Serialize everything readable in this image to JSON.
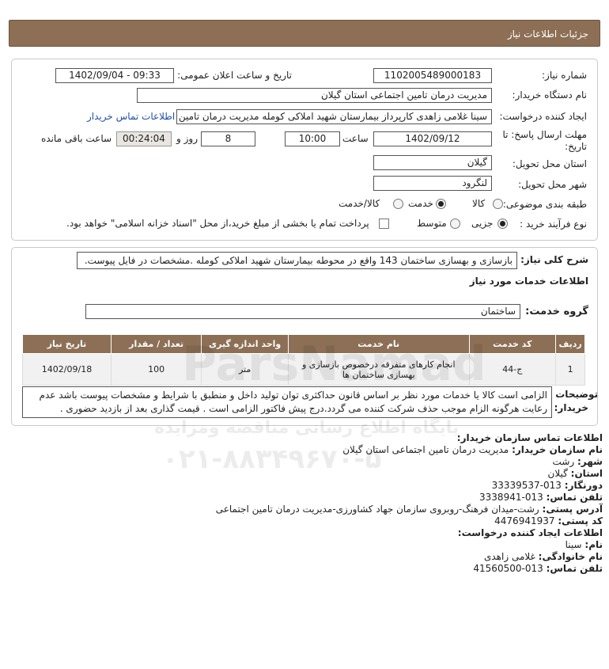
{
  "header": {
    "title": "جزئیات اطلاعات نیاز"
  },
  "form": {
    "need_number_label": "شماره نیاز:",
    "need_number": "1102005489000183",
    "announce_label": "تاریخ و ساعت اعلان عمومی:",
    "announce_value": "1402/09/04 - 09:33",
    "buyer_org_label": "نام دستگاه خریدار:",
    "buyer_org": "مدیریت درمان تامین اجتماعی استان گیلان",
    "creator_label": "ایجاد کننده درخواست:",
    "creator": "سینا غلامی زاهدی کارپرداز بیمارستان شهید املاکی کومله مدیریت درمان تامین",
    "contact_link": "اطلاعات تماس خریدار",
    "deadline_label_1": "مهلت ارسال پاسخ: تا",
    "deadline_label_2": "تاریخ:",
    "deadline_date": "1402/09/12",
    "time_label": "ساعت",
    "deadline_time": "10:00",
    "days": "8",
    "days_label": "روز و",
    "remaining": "00:24:04",
    "remaining_label": "ساعت باقی مانده",
    "province_label": "استان محل تحویل:",
    "province": "گیلان",
    "city_label": "شهر محل تحویل:",
    "city": "لنگرود",
    "category_label": "طبقه بندی موضوعی:",
    "category_options": [
      "کالا",
      "خدمت",
      "کالا/خدمت"
    ],
    "category_selected": "خدمت",
    "process_label": "نوع فرآیند خرید :",
    "process_options": [
      "جزیی",
      "متوسط"
    ],
    "process_selected": "جزیی",
    "payment_note": "پرداخت تمام یا بخشی از مبلغ خرید،از محل \"اسناد خزانه اسلامی\" خواهد بود."
  },
  "description": {
    "label": "شرح کلی نیاز:",
    "text": "بازسازی و بهسازی ساختمان 143 واقع در محوطه بیمارستان شهید املاکی کومله .مشخصات در فایل پیوست."
  },
  "services": {
    "section_title": "اطلاعات خدمات مورد نیاز",
    "group_label": "گروه خدمت:",
    "group_value": "ساختمان",
    "columns": [
      "ردیف",
      "کد خدمت",
      "نام خدمت",
      "واحد اندازه گیری",
      "تعداد / مقدار",
      "تاریخ نیاز"
    ],
    "rows": [
      {
        "index": "1",
        "code": "ج-44",
        "name": "انجام کارهای متفرقه درخصوص بازسازی و بهسازی ساختمان ها",
        "unit": "متر",
        "quantity": "100",
        "date": "1402/09/18"
      }
    ]
  },
  "notes": {
    "label_1": "توضیحات",
    "label_2": "خریدار:",
    "text": "الزامی است کالا یا خدمات مورد نظر بر اساس قانون حداکثری توان تولید داخل و منطبق با شرایط و مشخصات پیوست باشد عدم رعایت هرگونه الزام موجب حذف شرکت کننده می گردد.درج پیش فاکتور الزامی است . قیمت گذاری بعد از بازدید حضوری ."
  },
  "contact": {
    "org_title": "اطلاعات تماس سازمان خریدار:",
    "org_name_label": "نام سازمان خریدار:",
    "org_name": "مدیریت درمان تامین اجتماعی استان گیلان",
    "city_label": "شهر:",
    "city": "رشت",
    "province_label": "استان:",
    "province": "گیلان",
    "fax_label": "دورنگار:",
    "fax": "013-33339537",
    "phone_label": "تلفن تماس:",
    "phone": "013-3338941",
    "address_label": "آدرس پستی:",
    "address": "رشت-میدان فرهنگ-روبروی سازمان جهاد کشاورزی-مدیریت درمان تامین اجتماعی",
    "postal_label": "کد پستی:",
    "postal": "4476941937",
    "creator_title": "اطلاعات ایجاد کننده درخواست:",
    "first_name_label": "نام:",
    "first_name": "سینا",
    "last_name_label": "نام خانوادگی:",
    "last_name": "غلامی زاهدی",
    "creator_phone_label": "تلفن تماس:",
    "creator_phone": "013-41560500"
  },
  "watermark": {
    "brand": "ParsNamad",
    "line": "پایگاه اطلاع رسانی مناقصه ومزایده",
    "phone": "۰۲۱-۸۸۳۴۹۶۷۰-۵"
  }
}
